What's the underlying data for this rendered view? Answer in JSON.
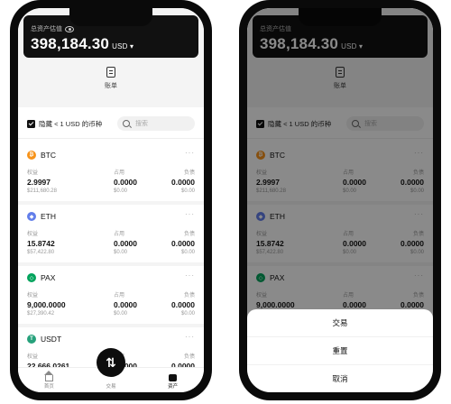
{
  "overview": {
    "total_label": "总资产估值",
    "total_value": "398,184.30",
    "currency": "USD ▾",
    "bill_label": "账单",
    "hide_small_label": "隐藏 < 1 USD 的币种",
    "search_placeholder": "搜索"
  },
  "columns": {
    "equity": "权益",
    "occupied": "占用",
    "liability": "负债"
  },
  "coins": [
    {
      "name": "BTC",
      "icon_color": "#f7931a",
      "icon_glyph": "₿",
      "equity": "2.9997",
      "equity_usd": "$211,680.28",
      "occupied": "0.0000",
      "occupied_usd": "$0.00",
      "liability": "0.0000",
      "liability_usd": "$0.00",
      "more": "···"
    },
    {
      "name": "ETH",
      "icon_color": "#627eea",
      "icon_glyph": "◆",
      "equity": "15.8742",
      "equity_usd": "$57,422.80",
      "occupied": "0.0000",
      "occupied_usd": "$0.00",
      "liability": "0.0000",
      "liability_usd": "$0.00",
      "more": "···"
    },
    {
      "name": "PAX",
      "icon_color": "#00a35c",
      "icon_glyph": "◇",
      "equity": "9,000.0000",
      "equity_usd": "$27,390.42",
      "occupied": "0.0000",
      "occupied_usd": "$0.00",
      "liability": "0.0000",
      "liability_usd": "$0.00",
      "more": "···"
    },
    {
      "name": "USDT",
      "icon_color": "#26a17b",
      "icon_glyph": "T",
      "equity": "22,666.0261",
      "equity_usd": "",
      "occupied": "0.0000",
      "occupied_usd": "",
      "liability": "0.0000",
      "liability_usd": "",
      "more": "···"
    }
  ],
  "tabbar": {
    "home": "首页",
    "trade": "交易",
    "assets": "资产"
  },
  "fab_glyph": "⇅",
  "sheet": {
    "trade": "交易",
    "reset": "重置",
    "cancel": "取消"
  }
}
